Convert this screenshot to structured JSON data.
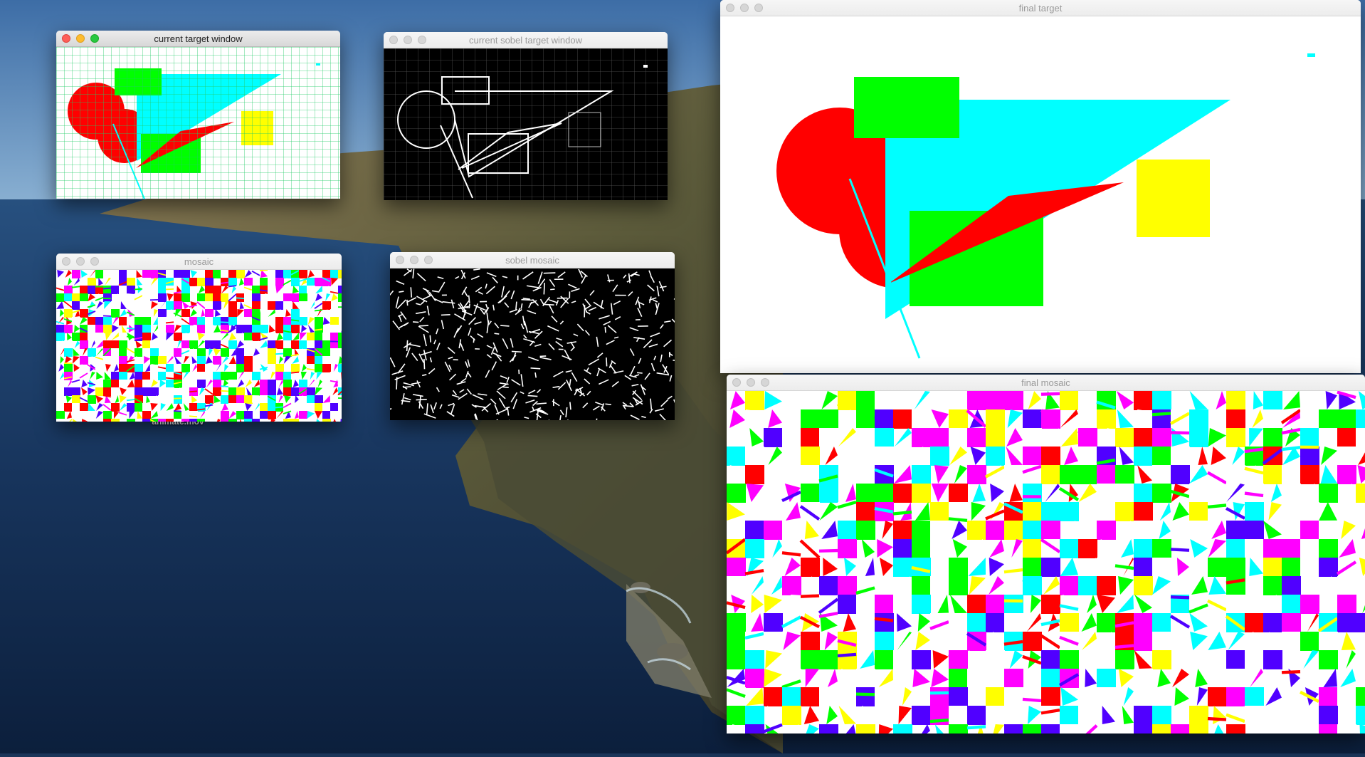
{
  "desktop": {
    "file_label": "animate.mov"
  },
  "windows": {
    "current_target": {
      "title": "current target window"
    },
    "current_sobel": {
      "title": "current sobel target window"
    },
    "mosaic": {
      "title": "mosaic"
    },
    "sobel_mosaic": {
      "title": "sobel mosaic"
    },
    "final_target": {
      "title": "final target"
    },
    "final_mosaic": {
      "title": "final mosaic"
    }
  },
  "colors": {
    "red": "#ff0000",
    "green": "#00ff00",
    "cyan": "#00ffff",
    "yellow": "#ffff00",
    "blue": "#5000ff",
    "magenta": "#ff00ff",
    "grid": "#22cc66"
  },
  "icons": {
    "close": "close-icon",
    "minimize": "minimize-icon",
    "zoom": "zoom-icon"
  }
}
